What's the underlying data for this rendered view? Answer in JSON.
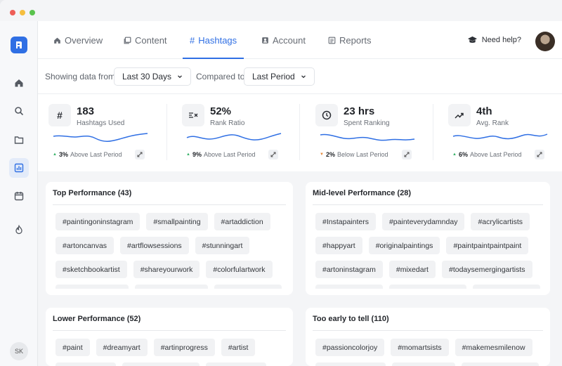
{
  "colors": {
    "accent": "#2f6fe4",
    "positive": "#3bb36b",
    "negative": "#e68a3b",
    "window_dots": [
      "#ee5e57",
      "#f5be3f",
      "#5ac34d"
    ]
  },
  "nav": {
    "tabs": [
      {
        "label": "Overview",
        "icon": "home-icon"
      },
      {
        "label": "Content",
        "icon": "gallery-icon"
      },
      {
        "label": "Hashtags",
        "icon": "hash-icon"
      },
      {
        "label": "Account",
        "icon": "account-icon"
      },
      {
        "label": "Reports",
        "icon": "report-icon"
      }
    ],
    "active_tab": "Hashtags",
    "help_label": "Need help?"
  },
  "filters": {
    "showing_label": "Showing data from",
    "range_value": "Last 30 Days",
    "compared_label": "Compared to",
    "compare_value": "Last Period"
  },
  "sidebar": {
    "icons": [
      "home-icon",
      "search-icon",
      "folder-icon",
      "chart-icon",
      "calendar-icon",
      "flame-icon"
    ],
    "active": "chart-icon",
    "user_initials": "SK"
  },
  "stats": [
    {
      "value": "183",
      "label": "Hashtags Used",
      "change": "3%",
      "direction": "up",
      "change_text": "Above Last Period",
      "icon": "hash-icon"
    },
    {
      "value": "52%",
      "label": "Rank Ratio",
      "change": "9%",
      "direction": "up",
      "change_text": "Above Last Period",
      "icon": "ratio-icon"
    },
    {
      "value": "23 hrs",
      "label": "Spent Ranking",
      "change": "2%",
      "direction": "down",
      "change_text": "Below Last Period",
      "icon": "clock-icon"
    },
    {
      "value": "4th",
      "label": "Avg. Rank",
      "change": "6%",
      "direction": "up",
      "change_text": "Above Last Period",
      "icon": "trend-icon"
    }
  ],
  "cards": [
    {
      "title": "Top Performance (43)",
      "rows": [
        [
          "#paintingoninstagram",
          "#smallpainting",
          "#artaddiction"
        ],
        [
          "#artoncanvas",
          "#artflowsessions",
          "#stunningart"
        ],
        [
          "#sketchbookartist",
          "#shareyourwork",
          "#colorfulartwork"
        ]
      ]
    },
    {
      "title": "Mid-level Performance (28)",
      "rows": [
        [
          "#Instapainters",
          "#painteverydamnday",
          "#acrylicartists"
        ],
        [
          "#happyart",
          "#originalpaintings",
          "#paintpaintpaintpaint"
        ],
        [
          "#artoninstagram",
          "#mixedart",
          "#todaysemergingartists"
        ]
      ]
    },
    {
      "title": "Lower Performance (52)",
      "rows": [
        [
          "#paint",
          "#dreamyart",
          "#artinprogress",
          "#artist"
        ]
      ]
    },
    {
      "title": "Too early to tell (110)",
      "rows": [
        [
          "#passioncolorjoy",
          "#momartsists",
          "#makemesmilenow"
        ]
      ]
    }
  ]
}
